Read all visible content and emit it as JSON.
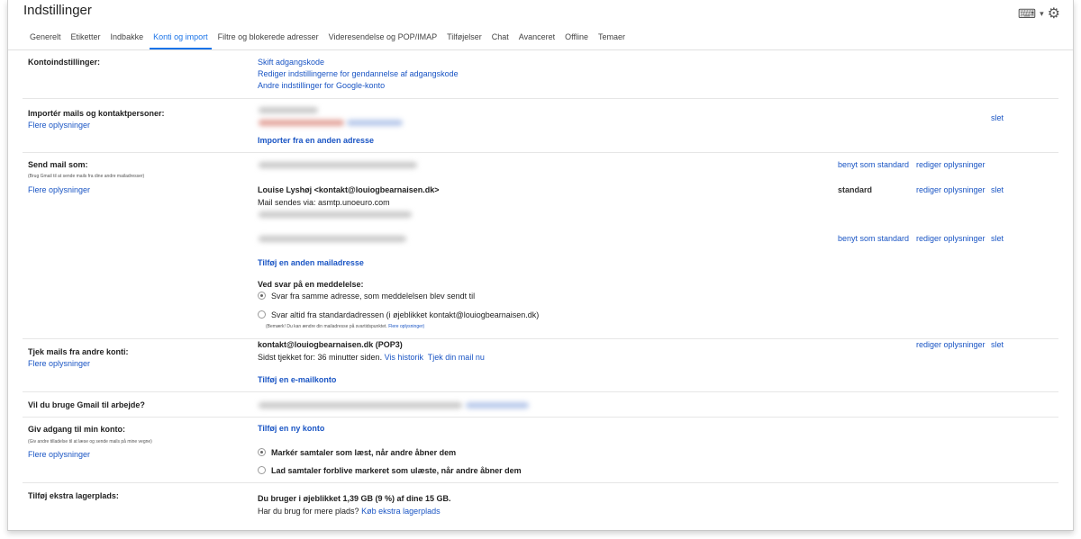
{
  "title": "Indstillinger",
  "icons": {
    "keyboard": "keyboard-icon",
    "dropdown": "chevron-down-icon",
    "settings": "gear-icon"
  },
  "colors": {
    "link": "#1a55c4",
    "active_tab": "#1a73e8"
  },
  "tabs": [
    {
      "label": "Generelt"
    },
    {
      "label": "Etiketter"
    },
    {
      "label": "Indbakke"
    },
    {
      "label": "Konti og import",
      "active": true
    },
    {
      "label": "Filtre og blokerede adresser"
    },
    {
      "label": "Videresendelse og POP/IMAP"
    },
    {
      "label": "Tilføjelser"
    },
    {
      "label": "Chat"
    },
    {
      "label": "Avanceret"
    },
    {
      "label": "Offline"
    },
    {
      "label": "Temaer"
    }
  ],
  "more_info": "Flere oplysninger",
  "account": {
    "label": "Kontoindstillinger:",
    "links": [
      "Skift adgangskode",
      "Rediger indstillingerne for gendannelse af adgangskode",
      "Andre indstillinger for Google-konto"
    ]
  },
  "import": {
    "label": "Importér mails og kontaktpersoner:",
    "delete": "slet",
    "import_other": "Importer fra en anden adresse"
  },
  "sendas": {
    "label": "Send mail som:",
    "sub": "(Brug Gmail til at sende mails fra dine andre mailadresser)",
    "set_default": "benyt som standard",
    "edit": "rediger oplysninger",
    "delete": "slet",
    "default_label": "standard",
    "account2": "Louise Lyshøj <kontakt@louiogbearnaisen.dk>",
    "account2_via": "Mail sendes via: asmtp.unoeuro.com",
    "add_address": "Tilføj en anden mailadresse",
    "reply_title": "Ved svar på en meddelelse:",
    "reply_opt1": "Svar fra samme adresse, som meddelelsen blev sendt til",
    "reply_opt2": "Svar altid fra standardadressen (i øjeblikket kontakt@louiogbearnaisen.dk)",
    "reply_note": "(Bemærk! Du kan ændre din mailadresse på svartidspunktet.",
    "reply_note_link": "Flere oplysninger)"
  },
  "check": {
    "label": "Tjek mails fra andre konti:",
    "account": "kontakt@louiogbearnaisen.dk (POP3)",
    "last_checked": "Sidst tjekket for: 36 minutter siden.",
    "history": "Vis historik",
    "check_now": "Tjek din mail nu",
    "edit": "rediger oplysninger",
    "delete": "slet",
    "add": "Tilføj en e-mailkonto"
  },
  "work": {
    "label": "Vil du bruge Gmail til arbejde?"
  },
  "grant": {
    "label": "Giv adgang til min konto:",
    "sub": "(Giv andre tilladelse til at læse og sende mails på mine vegne)",
    "add": "Tilføj en ny konto",
    "opt1": "Markér samtaler som læst, når andre åbner dem",
    "opt2": "Lad samtaler forblive markeret som ulæste, når andre åbner dem"
  },
  "storage": {
    "label": "Tilføj ekstra lagerplads:",
    "usage": "Du bruger i øjeblikket 1,39 GB (9 %) af dine 15 GB.",
    "more_q": "Har du brug for mere plads?",
    "buy": "Køb ekstra lagerplads"
  }
}
